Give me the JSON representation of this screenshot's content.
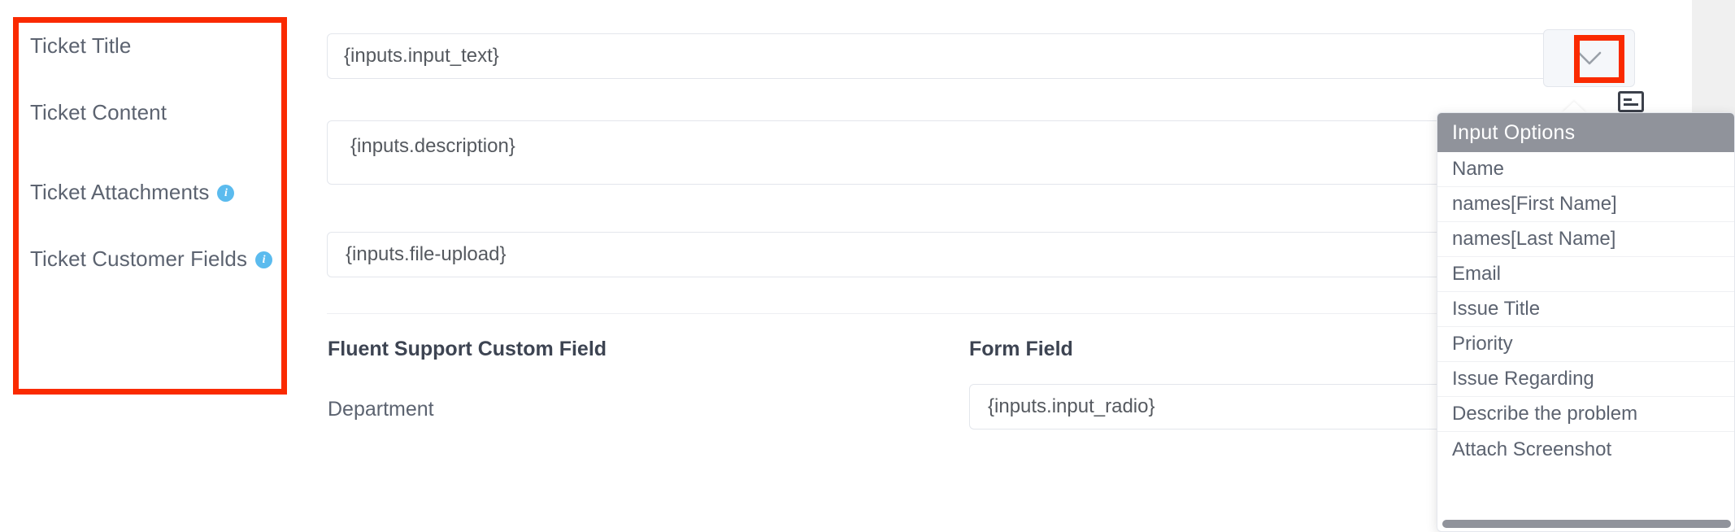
{
  "left_panel": {
    "highlighted": true,
    "highlight_color": "#fa2a00",
    "rows": [
      {
        "label": "Ticket Title",
        "has_info": false
      },
      {
        "label": "Ticket Content",
        "has_info": false
      },
      {
        "label": "Ticket Attachments",
        "has_info": true
      },
      {
        "label": "Ticket Customer Fields",
        "has_info": true
      }
    ],
    "info_icon_name": "info-icon",
    "info_icon_glyph": "i",
    "info_icon_color": "#5bbbee"
  },
  "fields": {
    "ticket_title_value": "{inputs.input_text}",
    "ticket_content_value": "{inputs.description}",
    "ticket_attachments_value": "{inputs.file-upload}",
    "custom_field_value": "{inputs.input_radio}"
  },
  "caret_button": {
    "icon_name": "chevron-down-icon",
    "highlighted": true,
    "highlight_color": "#fa2a00"
  },
  "form_glyph": {
    "icon_name": "form-list-icon"
  },
  "custom_field_table": {
    "columns": [
      "Fluent Support Custom Field",
      "Form Field"
    ],
    "rows": [
      {
        "custom_field": "Department",
        "form_field": "{inputs.input_radio}"
      }
    ]
  },
  "dropdown": {
    "title": "Input Options",
    "header_bg": "#90939b",
    "items": [
      "Name",
      "names[First Name]",
      "names[Last Name]",
      "Email",
      "Issue Title",
      "Priority",
      "Issue Regarding",
      "Describe the problem",
      "Attach Screenshot"
    ],
    "has_scrollbar": true
  }
}
